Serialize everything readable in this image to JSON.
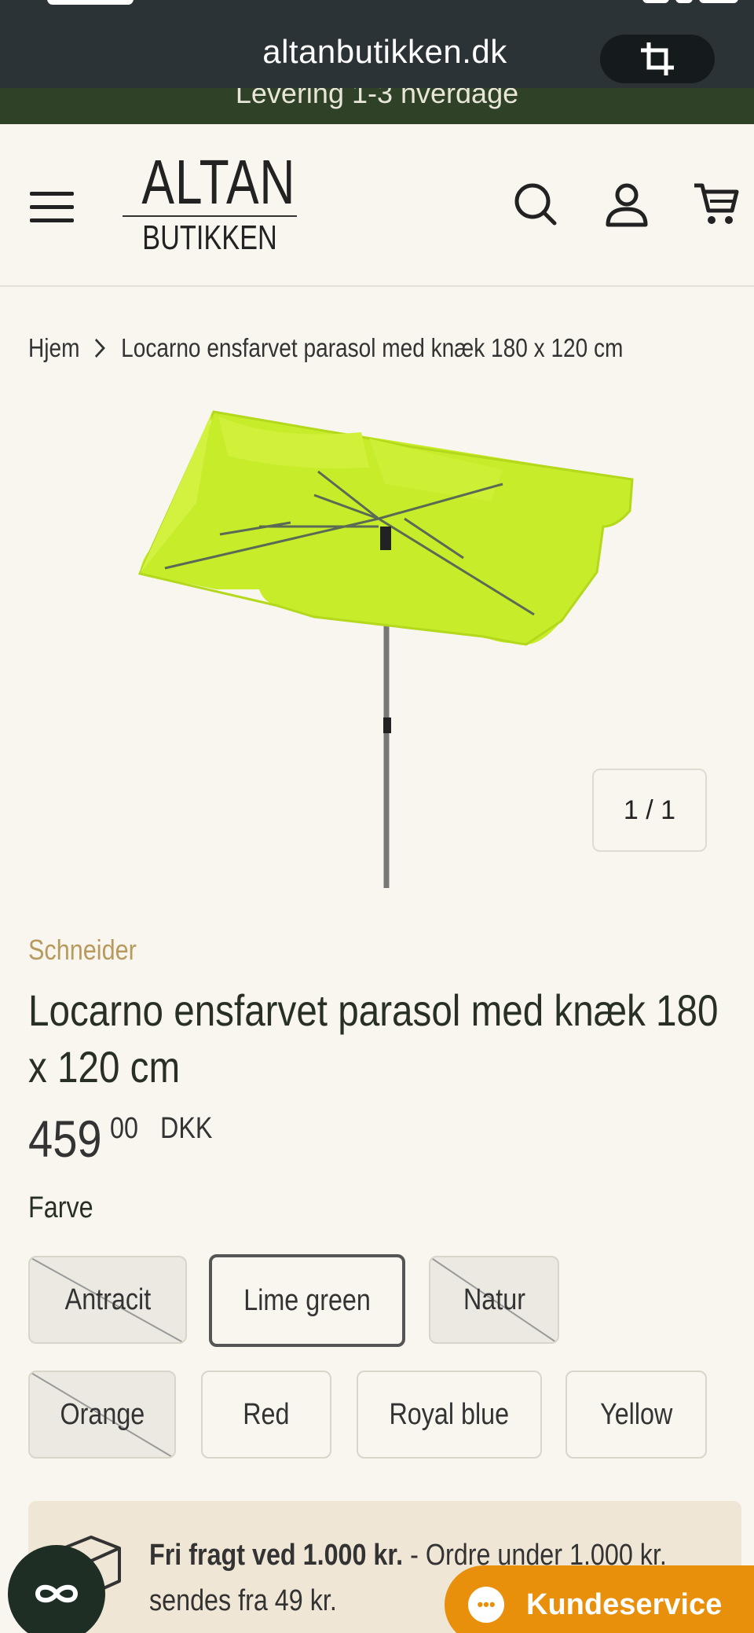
{
  "browser": {
    "url": "altanbutikken.dk"
  },
  "announcement": "Levering 1-3 hverdage",
  "logo": {
    "line1": "ALTAN",
    "line2": "BUTIKKEN"
  },
  "breadcrumb": {
    "home": "Hjem",
    "current": "Locarno ensfarvet parasol med knæk 180 x 120 cm"
  },
  "gallery": {
    "counter": "1 / 1"
  },
  "product": {
    "vendor": "Schneider",
    "title": "Locarno ensfarvet parasol med knæk 180 x 120 cm",
    "price_main": "459",
    "price_cents": "00",
    "currency": "DKK",
    "option_label": "Farve",
    "colors": [
      {
        "label": "Antracit",
        "state": "soldout"
      },
      {
        "label": "Lime green",
        "state": "selected"
      },
      {
        "label": "Natur",
        "state": "soldout"
      },
      {
        "label": "Orange",
        "state": "soldout"
      },
      {
        "label": "Red",
        "state": "available"
      },
      {
        "label": "Royal blue",
        "state": "available"
      },
      {
        "label": "Yellow",
        "state": "available"
      }
    ]
  },
  "shipping": {
    "bold": "Fri fragt ved 1.000 kr.",
    "rest": " - Ordre under 1.000 kr. sendes fra 49 kr."
  },
  "support": {
    "label": "Kundeservice"
  },
  "colors": {
    "accent": "#e8900c",
    "dark_green": "#2f4127",
    "vendor": "#b89a5e",
    "background": "#f8f6ee"
  }
}
